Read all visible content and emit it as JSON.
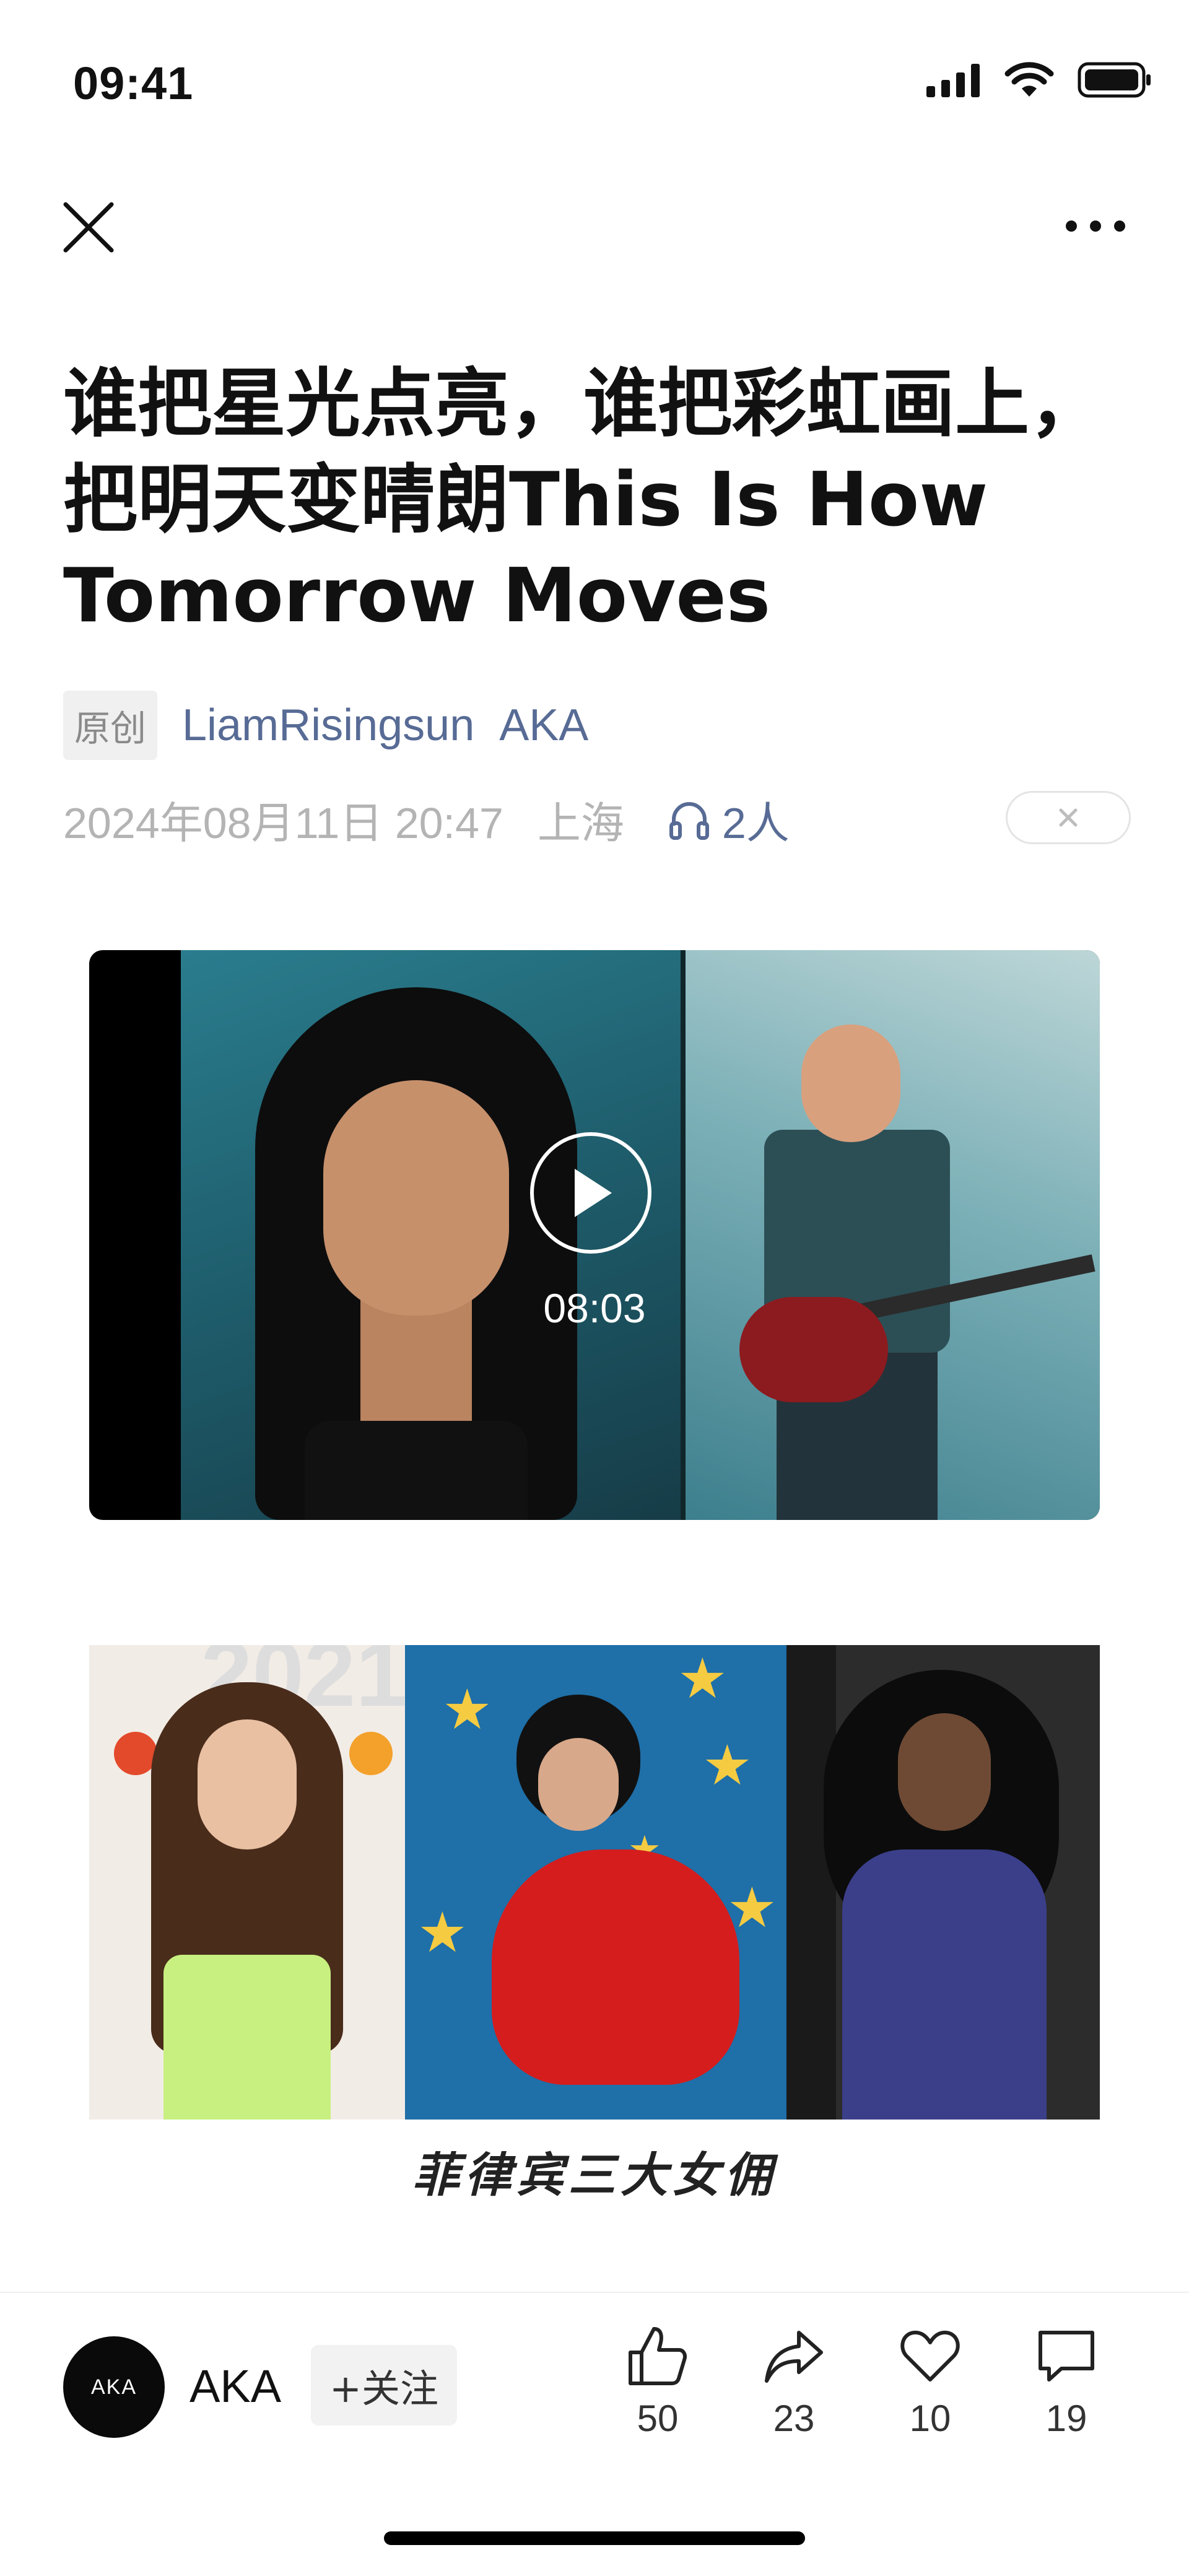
{
  "status_bar": {
    "time": "09:41"
  },
  "article": {
    "title": "谁把星光点亮，谁把彩虹画上，把明天变晴朗This Is How Tomorrow Moves",
    "original_tag": "原创",
    "author": "LiamRisingsun",
    "account": "AKA",
    "date": "2024年08月11日 20:47",
    "location": "上海",
    "listeners": "2人"
  },
  "video": {
    "duration": "08:03"
  },
  "image_caption": "菲律宾三大女佣",
  "bottom_bar": {
    "avatar_text": "AKA",
    "account_name": "AKA",
    "follow_label": "+关注",
    "likes": "50",
    "shares": "23",
    "favorites": "10",
    "comments": "19"
  }
}
